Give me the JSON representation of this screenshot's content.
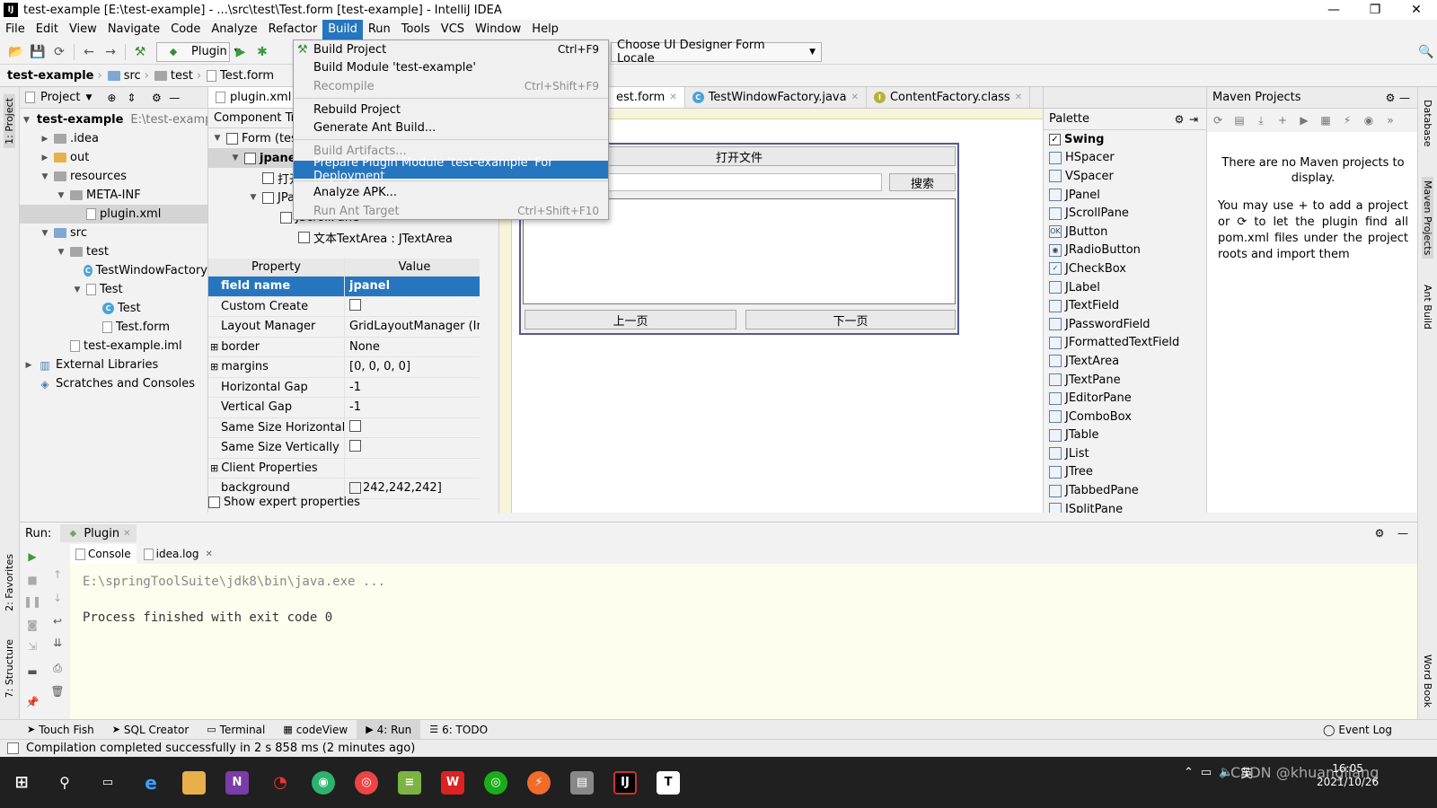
{
  "window": {
    "title": "test-example [E:\\test-example] - ...\\src\\test\\Test.form [test-example] - IntelliJ IDEA"
  },
  "menubar": {
    "items": [
      "File",
      "Edit",
      "View",
      "Navigate",
      "Code",
      "Analyze",
      "Refactor",
      "Build",
      "Run",
      "Tools",
      "VCS",
      "Window",
      "Help"
    ],
    "active": "Build"
  },
  "toolbar": {
    "run_config": "Plugin",
    "locale_combo": "Choose UI Designer Form Locale"
  },
  "breadcrumb": [
    "test-example",
    "src",
    "test",
    "Test.form"
  ],
  "build_menu": {
    "items": [
      {
        "label": "Build Project",
        "shortcut": "Ctrl+F9",
        "state": "normal"
      },
      {
        "label": "Build Module 'test-example'",
        "shortcut": "",
        "state": "normal"
      },
      {
        "label": "Recompile",
        "shortcut": "Ctrl+Shift+F9",
        "state": "disabled"
      },
      {
        "label": "Rebuild Project",
        "shortcut": "",
        "state": "normal"
      },
      {
        "label": "Generate Ant Build...",
        "shortcut": "",
        "state": "normal"
      },
      {
        "label": "Build Artifacts...",
        "shortcut": "",
        "state": "disabled"
      },
      {
        "label": "Prepare Plugin Module 'test-example' For Deployment",
        "shortcut": "",
        "state": "highlighted"
      },
      {
        "label": "Analyze APK...",
        "shortcut": "",
        "state": "normal"
      },
      {
        "label": "Run Ant Target",
        "shortcut": "Ctrl+Shift+F10",
        "state": "disabled"
      }
    ]
  },
  "project": {
    "header": "Project",
    "tree": [
      {
        "label": "test-example",
        "extra": "E:\\test-exampl",
        "depth": 0,
        "icon": "folder",
        "arrow": "down",
        "bold": true
      },
      {
        "label": ".idea",
        "depth": 1,
        "icon": "folder",
        "arrow": "right"
      },
      {
        "label": "out",
        "depth": 1,
        "icon": "folder-y",
        "arrow": "right"
      },
      {
        "label": "resources",
        "depth": 1,
        "icon": "folder",
        "arrow": "down"
      },
      {
        "label": "META-INF",
        "depth": 2,
        "icon": "folder",
        "arrow": "down"
      },
      {
        "label": "plugin.xml",
        "depth": 3,
        "icon": "file",
        "arrow": "",
        "selected": true
      },
      {
        "label": "src",
        "depth": 1,
        "icon": "folder-b",
        "arrow": "down"
      },
      {
        "label": "test",
        "depth": 2,
        "icon": "folder",
        "arrow": "down"
      },
      {
        "label": "TestWindowFactory",
        "depth": 3,
        "icon": "class",
        "arrow": ""
      },
      {
        "label": "Test",
        "depth": 3,
        "icon": "file",
        "arrow": "down"
      },
      {
        "label": "Test",
        "depth": 4,
        "icon": "class",
        "arrow": ""
      },
      {
        "label": "Test.form",
        "depth": 4,
        "icon": "file",
        "arrow": ""
      },
      {
        "label": "test-example.iml",
        "depth": 2,
        "icon": "file",
        "arrow": ""
      },
      {
        "label": "External Libraries",
        "depth": 0,
        "icon": "lib",
        "arrow": "right"
      },
      {
        "label": "Scratches and Consoles",
        "depth": 0,
        "icon": "scratch",
        "arrow": ""
      }
    ]
  },
  "component_tree": {
    "header": "Component Tree",
    "tab": "plugin.xml (c",
    "nodes": [
      {
        "label": "Form (tes",
        "depth": 0
      },
      {
        "label": "jpanel",
        "depth": 1,
        "selected": true
      },
      {
        "label": "打开",
        "depth": 2
      },
      {
        "label": "JPa",
        "depth": 2
      },
      {
        "label": "JScrollPane",
        "depth": 3
      },
      {
        "label": "文本TextArea : JTextArea",
        "depth": 4
      }
    ]
  },
  "properties": {
    "col_property": "Property",
    "col_value": "Value",
    "rows": [
      {
        "k": "field name",
        "v": "jpanel",
        "sel": true,
        "exp": false
      },
      {
        "k": "Custom Create",
        "v": "",
        "check": true,
        "exp": false
      },
      {
        "k": "Layout Manager",
        "v": "GridLayoutManager (Int...",
        "exp": false
      },
      {
        "k": "border",
        "v": "None",
        "exp": true
      },
      {
        "k": "margins",
        "v": "[0, 0, 0, 0]",
        "exp": true
      },
      {
        "k": "Horizontal Gap",
        "v": "-1",
        "exp": false
      },
      {
        "k": "Vertical Gap",
        "v": "-1",
        "exp": false
      },
      {
        "k": "Same Size Horizontally",
        "v": "",
        "check": true,
        "exp": false
      },
      {
        "k": "Same Size Vertically",
        "v": "",
        "check": true,
        "exp": false
      },
      {
        "k": "Client Properties",
        "v": "",
        "exp": true
      },
      {
        "k": "background",
        "v": "242,242,242]",
        "swatch": true,
        "exp": false
      }
    ],
    "expert_label": "Show expert properties"
  },
  "editor_tabs": [
    "est.form",
    "TestWindowFactory.java",
    "ContentFactory.class"
  ],
  "designer": {
    "open_btn": "打开文件",
    "search_btn": "搜索",
    "prev_btn": "上一页",
    "next_btn": "下一页"
  },
  "palette": {
    "header": "Palette",
    "group": "Swing",
    "items": [
      "HSpacer",
      "VSpacer",
      "JPanel",
      "JScrollPane",
      "JButton",
      "JRadioButton",
      "JCheckBox",
      "JLabel",
      "JTextField",
      "JPasswordField",
      "JFormattedTextField",
      "JTextArea",
      "JTextPane",
      "JEditorPane",
      "JComboBox",
      "JTable",
      "JList",
      "JTree",
      "JTabbedPane",
      "JSplitPane"
    ]
  },
  "maven": {
    "header": "Maven Projects",
    "msg1": "There are no Maven projects to display.",
    "msg2": "You may use + to add a project or ⟳ to let the plugin find all pom.xml files under the project roots and import them"
  },
  "run": {
    "label": "Run:",
    "config_tab": "Plugin",
    "tab_console": "Console",
    "tab_log": "idea.log",
    "line1": "E:\\springToolSuite\\jdk8\\bin\\java.exe ...",
    "line2": "Process finished with exit code 0"
  },
  "left_strip": {
    "project": "1: Project",
    "favorites": "2: Favorites",
    "structure": "7: Structure"
  },
  "right_strip": {
    "database": "Database",
    "maven": "Maven Projects",
    "ant": "Ant Build",
    "wordbook": "Word Book"
  },
  "bottom_tabs": [
    "Touch Fish",
    "SQL Creator",
    "Terminal",
    "codeView",
    "4: Run",
    "6: TODO"
  ],
  "event_log": "Event Log",
  "status": "Compilation completed successfully in 2 s 858 ms (2 minutes ago)",
  "taskbar": {
    "time": "16:05",
    "date": "2021/10/26",
    "ime": "英",
    "watermark": "CSDN @khuangliang"
  }
}
